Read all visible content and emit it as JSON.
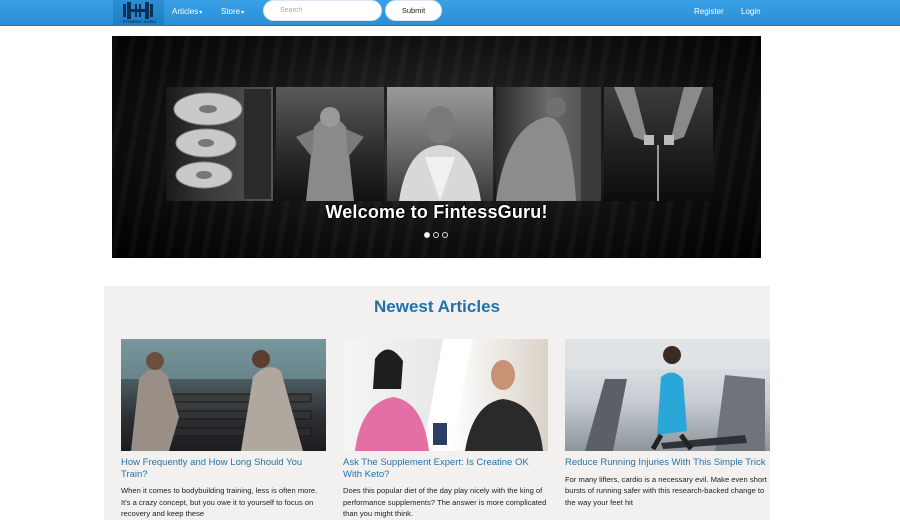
{
  "navbar": {
    "logo_text": "FITNESS GURU",
    "menu": [
      {
        "label": "Articles"
      },
      {
        "label": "Store"
      }
    ],
    "search": {
      "placeholder": "Search",
      "value": ""
    },
    "submit_label": "Submit",
    "register_label": "Register",
    "login_label": "Login"
  },
  "carousel": {
    "caption": "Welcome to FintessGuru!",
    "slides_count": 3,
    "active_slide": 1
  },
  "articles": {
    "heading": "Newest Articles",
    "items": [
      {
        "title": "How Frequently and How Long Should You Train?",
        "excerpt": "When it comes to bodybuilding training, less is often more. It's a crazy concept, but you owe it to yourself to focus on recovery and keep these"
      },
      {
        "title": "Ask The Supplement Expert: Is Creatine OK With Keto?",
        "excerpt": "Does this popular diet of the day play nicely with the king of performance supplements? The answer is more complicated than you might think."
      },
      {
        "title": "Reduce Running Injuries With This Simple Trick",
        "excerpt": "For many lifters, cardio is a necessary evil. Make even short bursts of running safer with this research-backed change to the way your feet hit"
      }
    ]
  },
  "colors": {
    "navbar": "#2a8fd6",
    "link": "#2773a6",
    "heading": "#2272a8",
    "articles_bg": "#f2f1f0"
  }
}
